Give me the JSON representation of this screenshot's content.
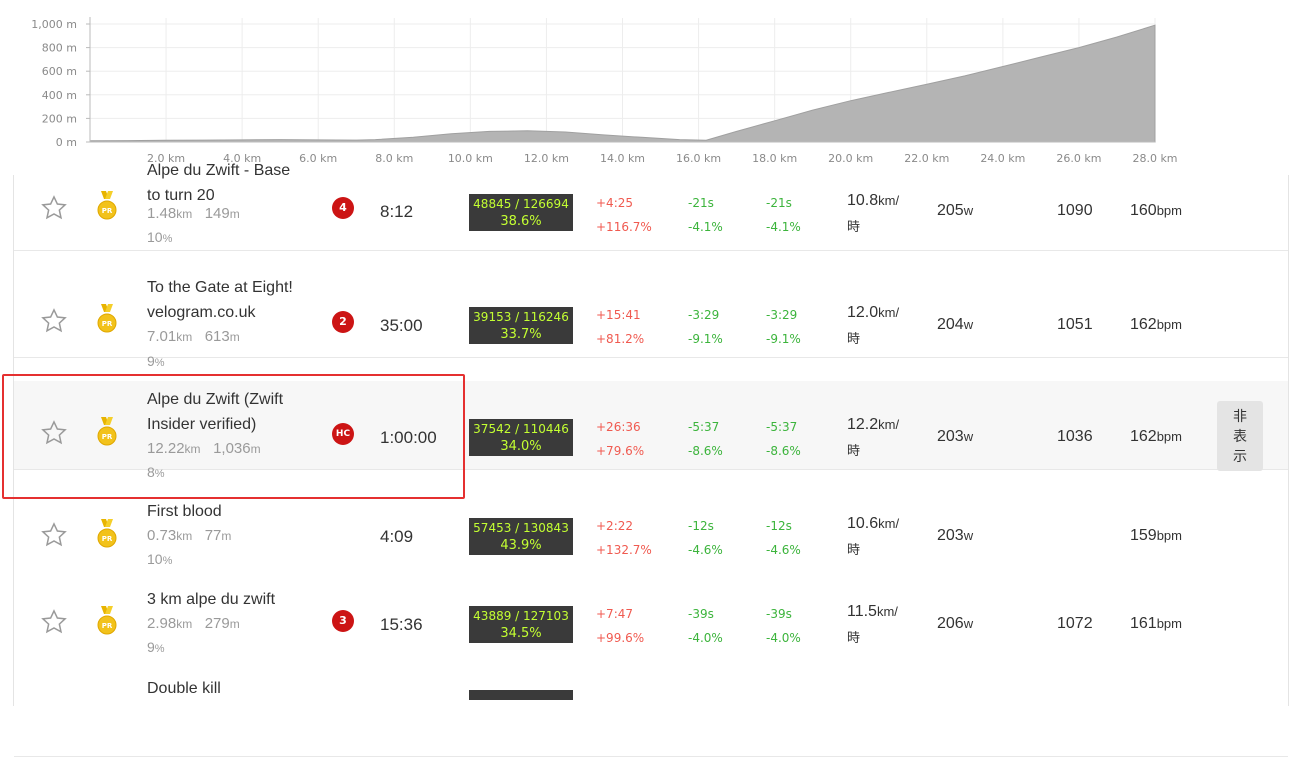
{
  "chart_data": {
    "type": "area",
    "y_ticks": [
      "1,000 m",
      "800 m",
      "600 m",
      "400 m",
      "200 m",
      "0 m"
    ],
    "x_ticks": [
      "2.0 km",
      "4.0 km",
      "6.0 km",
      "8.0 km",
      "10.0 km",
      "12.0 km",
      "14.0 km",
      "16.0 km",
      "18.0 km",
      "20.0 km",
      "22.0 km",
      "24.0 km",
      "26.0 km",
      "28.0 km"
    ],
    "ylim": [
      0,
      1000
    ],
    "xlim": [
      0,
      28
    ],
    "x": [
      0,
      1,
      2,
      3,
      4,
      5,
      6,
      7,
      7.5,
      8.5,
      9.5,
      10.5,
      11.5,
      12.5,
      13.5,
      14.5,
      15.5,
      16.2,
      17,
      18,
      19,
      20,
      21,
      22,
      23,
      24,
      25,
      26,
      27,
      28
    ],
    "y": [
      10,
      12,
      14,
      16,
      18,
      20,
      18,
      16,
      20,
      40,
      70,
      90,
      95,
      85,
      60,
      40,
      20,
      15,
      90,
      180,
      270,
      350,
      420,
      490,
      560,
      640,
      720,
      800,
      890,
      990
    ],
    "grid": true,
    "color": "#b4b4b4"
  },
  "rows": [
    {
      "name_line1": "Alpe du Zwift - Base",
      "name_line2": "to turn 20",
      "distance": "1.48",
      "distance_unit": "km",
      "elevation": "149",
      "elevation_unit": "m",
      "grade": "10",
      "grade_unit": "%",
      "category": "4",
      "time": "8:12",
      "rank": "48845 / 126694",
      "rank_pct": "38.6%",
      "diff_a1": "+4:25",
      "diff_a2": "+116.7%",
      "diff_b1": "-21s",
      "diff_b2": "-4.1%",
      "diff_c1": "-21s",
      "diff_c2": "-4.1%",
      "speed": "10.8",
      "speed_unit1": "km/",
      "speed_unit2": "時",
      "watts": "205",
      "watts_unit": "w",
      "kj": "1090",
      "hr": "160",
      "hr_unit": "bpm"
    },
    {
      "name_line1": "To the Gate at Eight!",
      "name_line2": "velogram.co.uk",
      "distance": "7.01",
      "distance_unit": "km",
      "elevation": "613",
      "elevation_unit": "m",
      "grade": "9",
      "grade_unit": "%",
      "category": "2",
      "time": "35:00",
      "rank": "39153 / 116246",
      "rank_pct": "33.7%",
      "diff_a1": "+15:41",
      "diff_a2": "+81.2%",
      "diff_b1": "-3:29",
      "diff_b2": "-9.1%",
      "diff_c1": "-3:29",
      "diff_c2": "-9.1%",
      "speed": "12.0",
      "speed_unit1": "km/",
      "speed_unit2": "時",
      "watts": "204",
      "watts_unit": "w",
      "kj": "1051",
      "hr": "162",
      "hr_unit": "bpm"
    },
    {
      "name_line1": "Alpe du Zwift (Zwift",
      "name_line2": "Insider verified)",
      "distance": "12.22",
      "distance_unit": "km",
      "elevation": "1,036",
      "elevation_unit": "m",
      "grade": "8",
      "grade_unit": "%",
      "category": "HC",
      "time": "1:00:00",
      "rank": "37542 / 110446",
      "rank_pct": "34.0%",
      "diff_a1": "+26:36",
      "diff_a2": "+79.6%",
      "diff_b1": "-5:37",
      "diff_b2": "-8.6%",
      "diff_c1": "-5:37",
      "diff_c2": "-8.6%",
      "speed": "12.2",
      "speed_unit1": "km/",
      "speed_unit2": "時",
      "watts": "203",
      "watts_unit": "w",
      "kj": "1036",
      "hr": "162",
      "hr_unit": "bpm",
      "hide_label": "非表示"
    },
    {
      "name_line1": "First blood",
      "name_line2": "",
      "distance": "0.73",
      "distance_unit": "km",
      "elevation": "77",
      "elevation_unit": "m",
      "grade": "10",
      "grade_unit": "%",
      "category": "",
      "time": "4:09",
      "rank": "57453 / 130843",
      "rank_pct": "43.9%",
      "diff_a1": "+2:22",
      "diff_a2": "+132.7%",
      "diff_b1": "-12s",
      "diff_b2": "-4.6%",
      "diff_c1": "-12s",
      "diff_c2": "-4.6%",
      "speed": "10.6",
      "speed_unit1": "km/",
      "speed_unit2": "時",
      "watts": "203",
      "watts_unit": "w",
      "kj": "",
      "hr": "159",
      "hr_unit": "bpm"
    },
    {
      "name_line1": "3 km alpe du zwift",
      "name_line2": "",
      "distance": "2.98",
      "distance_unit": "km",
      "elevation": "279",
      "elevation_unit": "m",
      "grade": "9",
      "grade_unit": "%",
      "category": "3",
      "time": "15:36",
      "rank": "43889 / 127103",
      "rank_pct": "34.5%",
      "diff_a1": "+7:47",
      "diff_a2": "+99.6%",
      "diff_b1": "-39s",
      "diff_b2": "-4.0%",
      "diff_c1": "-39s",
      "diff_c2": "-4.0%",
      "speed": "11.5",
      "speed_unit1": "km/",
      "speed_unit2": "時",
      "watts": "206",
      "watts_unit": "w",
      "kj": "1072",
      "hr": "161",
      "hr_unit": "bpm"
    },
    {
      "name_line1": "Double kill"
    }
  ]
}
